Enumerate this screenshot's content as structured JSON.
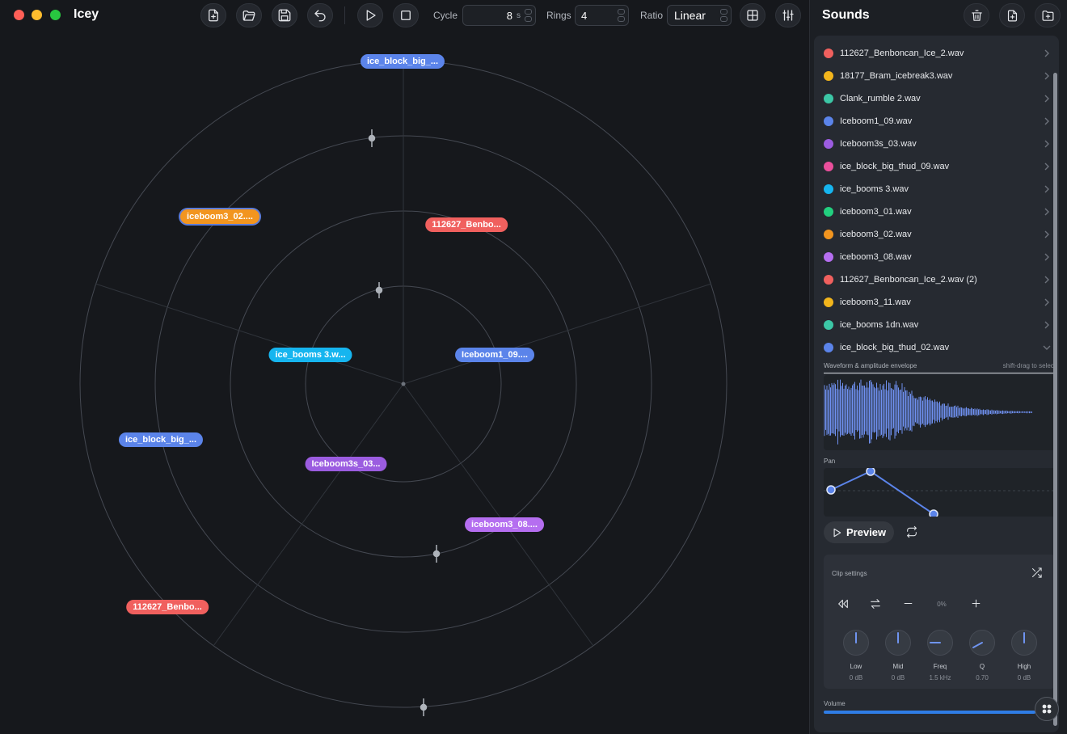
{
  "app": {
    "title": "Icey"
  },
  "toolbar": {
    "cycle_label": "Cycle",
    "cycle_value": "8",
    "cycle_unit": "s",
    "rings_label": "Rings",
    "rings_value": "4",
    "ratio_label": "Ratio",
    "ratio_value": "Linear"
  },
  "sidebar": {
    "title": "Sounds",
    "sounds": [
      {
        "name": "112627_Benboncan_Ice_2.wav",
        "color": "#f0605e"
      },
      {
        "name": "18177_Bram_icebreak3.wav",
        "color": "#f2b51c"
      },
      {
        "name": "Clank_rumble 2.wav",
        "color": "#3cc7a6"
      },
      {
        "name": "Iceboom1_09.wav",
        "color": "#5b84ea"
      },
      {
        "name": "Iceboom3s_03.wav",
        "color": "#9b5ce0"
      },
      {
        "name": "ice_block_big_thud_09.wav",
        "color": "#ea4f9c"
      },
      {
        "name": "ice_booms 3.wav",
        "color": "#16b5ef"
      },
      {
        "name": "iceboom3_01.wav",
        "color": "#22cf7f"
      },
      {
        "name": "iceboom3_02.wav",
        "color": "#f2951f"
      },
      {
        "name": "iceboom3_08.wav",
        "color": "#b56ef0"
      },
      {
        "name": "112627_Benboncan_Ice_2.wav (2)",
        "color": "#f0605e"
      },
      {
        "name": "iceboom3_11.wav",
        "color": "#f2b51c"
      },
      {
        "name": "ice_booms 1dn.wav",
        "color": "#3cc7a6"
      },
      {
        "name": "ice_block_big_thud_02.wav",
        "color": "#5b84ea"
      }
    ],
    "waveform_label": "Waveform & amplitude envelope",
    "waveform_hint": "shift-drag to select",
    "pan_label": "Pan",
    "preview_label": "Preview",
    "clip_settings_label": "Clip settings",
    "gain_value": "0%",
    "knobs": [
      {
        "label": "Low",
        "value": "0 dB"
      },
      {
        "label": "Mid",
        "value": "0 dB"
      },
      {
        "label": "Freq",
        "value": "1.5 kHz"
      },
      {
        "label": "Q",
        "value": "0.70"
      },
      {
        "label": "High",
        "value": "0 dB"
      }
    ],
    "volume_label": "Volume"
  },
  "canvas": {
    "clips": [
      {
        "label": "ice_block_big_...",
        "color": "#5b84ea"
      },
      {
        "label": "iceboom3_02....",
        "color": "#f2951f"
      },
      {
        "label": "112627_Benbo...",
        "color": "#f0605e"
      },
      {
        "label": "ice_booms 3.w...",
        "color": "#16b5ef"
      },
      {
        "label": "Iceboom1_09....",
        "color": "#5b84ea"
      },
      {
        "label": "ice_block_big_...",
        "color": "#5b84ea"
      },
      {
        "label": "Iceboom3s_03...",
        "color": "#9b5ce0"
      },
      {
        "label": "iceboom3_08....",
        "color": "#b56ef0"
      },
      {
        "label": "112627_Benbo...",
        "color": "#f0605e"
      }
    ]
  }
}
